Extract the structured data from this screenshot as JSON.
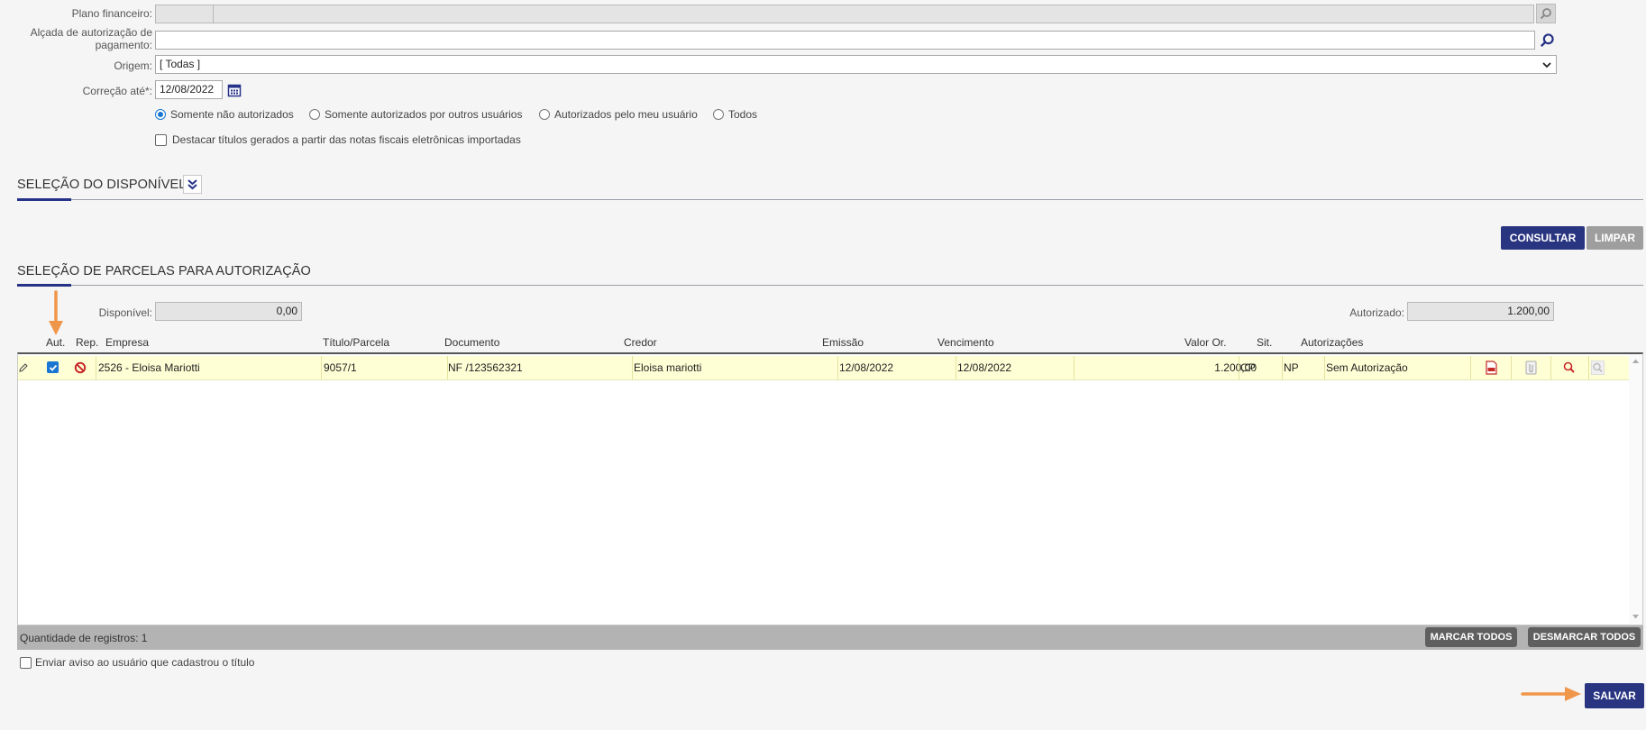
{
  "filters": {
    "plano_label": "Plano financeiro:",
    "alcada_label_line1": "Alçada de autorização de",
    "alcada_label_line2": "pagamento:",
    "origem_label": "Origem:",
    "origem_value": "[ Todas ]",
    "correcao_label": "Correção até*:",
    "correcao_value": "12/08/2022",
    "radios": [
      {
        "label": "Somente não autorizados",
        "selected": true
      },
      {
        "label": "Somente autorizados por outros usuários",
        "selected": false
      },
      {
        "label": "Autorizados pelo meu usuário",
        "selected": false
      },
      {
        "label": "Todos",
        "selected": false
      }
    ],
    "destacar_label": "Destacar títulos gerados a partir das notas fiscais eletrônicas importadas"
  },
  "section_disponivel": {
    "title": "SELEÇÃO DO DISPONÍVEL"
  },
  "actions": {
    "consultar": "CONSULTAR",
    "limpar": "LIMPAR"
  },
  "section_parcelas": {
    "title": "SELEÇÃO DE PARCELAS PARA AUTORIZAÇÃO"
  },
  "totals": {
    "disponivel_label": "Disponível:",
    "disponivel_value": "0,00",
    "autorizado_label": "Autorizado:",
    "autorizado_value": "1.200,00"
  },
  "table": {
    "headers": {
      "aut": "Aut.",
      "rep": "Rep.",
      "empresa": "Empresa",
      "titulo": "Título/Parcela",
      "documento": "Documento",
      "credor": "Credor",
      "emissao": "Emissão",
      "vencimento": "Vencimento",
      "valor": "Valor Or.",
      "sit": "Sit.",
      "autorizacoes": "Autorizações"
    },
    "rows": [
      {
        "aut_checked": true,
        "empresa": "2526 - Eloisa Mariotti",
        "titulo": "9057/1",
        "documento": "NF /123562321",
        "credor": "Eloisa mariotti",
        "emissao": "12/08/2022",
        "vencimento": "12/08/2022",
        "valor": "1.200,00",
        "tipo": "CP",
        "sit": "NP",
        "autorizacoes": "Sem Autorização"
      }
    ],
    "footer_count": "Quantidade de registros: 1",
    "marcar_todos": "MARCAR TODOS",
    "desmarcar_todos": "DESMARCAR TODOS"
  },
  "enviar_aviso_label": "Enviar aviso ao usuário que cadastrou o título",
  "salvar": "SALVAR",
  "colors": {
    "primary": "#293580",
    "row_highlight": "#ffffd6",
    "arrow": "#f0964a",
    "checkbox_blue": "#1976d2",
    "rep_red": "#c62828"
  }
}
